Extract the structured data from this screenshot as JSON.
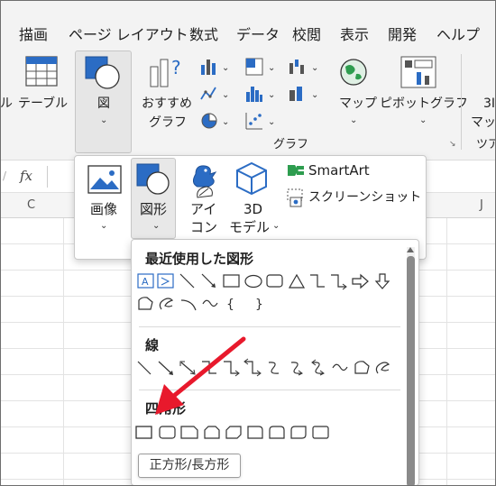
{
  "menu": {
    "tabs": [
      "描画",
      "ページ レイアウト",
      "数式",
      "データ",
      "校閲",
      "表示",
      "開発",
      "ヘルプ"
    ]
  },
  "ribbon": {
    "table_label": "テーブル",
    "left_cut_label": "ル",
    "figure_label": "図",
    "recommended_label_1": "おすすめ",
    "recommended_label_2": "グラフ",
    "map_label": "マップ",
    "pivot_label": "ピボットグラフ",
    "threed_map_1": "3I",
    "threed_map_2": "マップ",
    "group_chart_label": "グラフ",
    "group_tour_label": "ツア"
  },
  "formula_bar": {
    "fx_label": "fx"
  },
  "columns": {
    "c": "C",
    "j": "J"
  },
  "insert_panel": {
    "image_label": "画像",
    "shape_label": "図形",
    "icon_label_1": "アイ",
    "icon_label_2": "コン",
    "model_label_1": "3D",
    "model_label_2": "モデル",
    "smartart_label": "SmartArt",
    "screenshot_label": "スクリーンショット"
  },
  "shapes_gallery": {
    "recent_title": "最近使用した図形",
    "lines_title": "線",
    "rect_title": "四角形",
    "tooltip": "正方形/長方形"
  },
  "colors": {
    "accent_blue": "#2b6cc4",
    "arrow_red": "#e8192c"
  }
}
